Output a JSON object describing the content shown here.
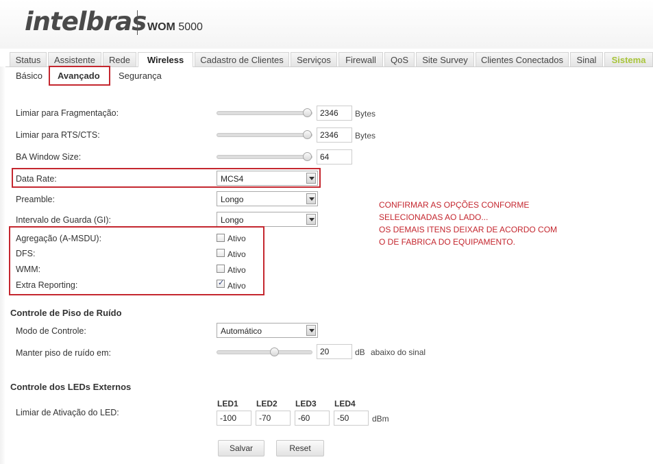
{
  "header": {
    "brand": "intelbras",
    "model_bold": "WOM",
    "model_num": "5000"
  },
  "tabs": [
    "Status",
    "Assistente",
    "Rede",
    "Wireless",
    "Cadastro de Clientes",
    "Serviços",
    "Firewall",
    "QoS",
    "Site Survey",
    "Clientes Conectados",
    "Sinal",
    "Sistema"
  ],
  "active_tab": "Wireless",
  "subtabs": [
    "Básico",
    "Avançado",
    "Segurança"
  ],
  "active_subtab": "Avançado",
  "form": {
    "frag_label": "Limiar para Fragmentação:",
    "frag_value": "2346",
    "frag_unit": "Bytes",
    "rts_label": "Limiar para RTS/CTS:",
    "rts_value": "2346",
    "rts_unit": "Bytes",
    "ba_label": "BA Window Size:",
    "ba_value": "64",
    "datarate_label": "Data Rate:",
    "datarate_value": "MCS4",
    "preamble_label": "Preamble:",
    "preamble_value": "Longo",
    "gi_label": "Intervalo de Guarda (GI):",
    "gi_value": "Longo",
    "amsdu_label": "Agregação (A-MSDU):",
    "amsdu_checked": false,
    "dfs_label": "DFS:",
    "dfs_checked": false,
    "wmm_label": "WMM:",
    "wmm_checked": false,
    "extra_label": "Extra Reporting:",
    "extra_checked": true,
    "ativo": "Ativo"
  },
  "noise": {
    "section": "Controle de Piso de Ruído",
    "mode_label": "Modo de Controle:",
    "mode_value": "Automático",
    "floor_label": "Manter piso de ruído em:",
    "floor_value": "20",
    "floor_unit": "dB",
    "floor_suffix": "abaixo do sinal"
  },
  "leds": {
    "section": "Controle dos LEDs Externos",
    "label": "Limiar de Ativação do LED:",
    "headers": [
      "LED1",
      "LED2",
      "LED3",
      "LED4"
    ],
    "values": [
      "-100",
      "-70",
      "-60",
      "-50"
    ],
    "unit": "dBm"
  },
  "buttons": {
    "save": "Salvar",
    "reset": "Reset"
  },
  "note": {
    "line1": "CONFIRMAR AS OPÇÕES CONFORME",
    "line2": "SELECIONADAS AO LADO...",
    "line3": "OS DEMAIS ITENS DEIXAR DE ACORDO COM",
    "line4": "O DE FABRICA DO EQUIPAMENTO."
  },
  "colors": {
    "annotation_red": "#c4262e",
    "sistema_green": "#a8c43a"
  }
}
